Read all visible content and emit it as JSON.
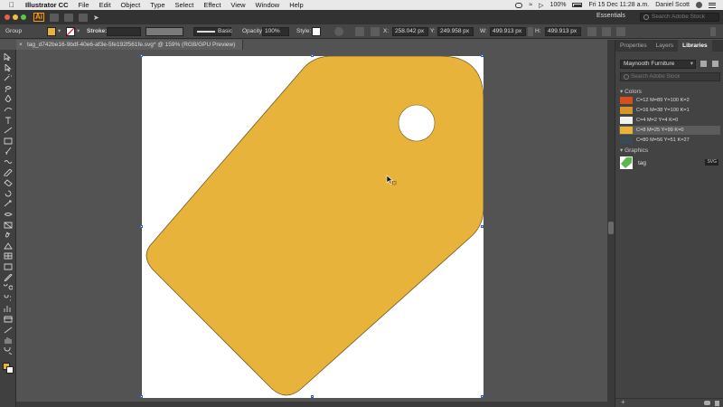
{
  "mac_menu": {
    "app_name": "Illustrator CC",
    "items": [
      "File",
      "Edit",
      "Object",
      "Type",
      "Select",
      "Effect",
      "View",
      "Window",
      "Help"
    ],
    "battery": "100%",
    "datetime": "Fri 15 Dec  11:28 a.m.",
    "user": "Daniel Scott"
  },
  "app_bar": {
    "logo": "Ai",
    "workspace": "Essentials",
    "search_placeholder": "Search Adobe Stock"
  },
  "control_bar": {
    "selection_label": "Group",
    "stroke_label": "Stroke:",
    "brush_label": "Basic",
    "opacity_label": "Opacity:",
    "opacity_value": "100%",
    "style_label": "Style:",
    "x_label": "X:",
    "x_value": "258.042 px",
    "y_label": "Y:",
    "y_value": "249.958 px",
    "w_label": "W:",
    "w_value": "499.913 px",
    "h_label": "H:",
    "h_value": "499.913 px",
    "fill_color": "#e8b33a"
  },
  "document_tab": {
    "title": "tag_d742be16-9bdf-40e6-af3e-5fe192f561fe.svg* @ 159% (RGB/GPU Preview)",
    "close": "×"
  },
  "artwork": {
    "tag_color": "#e8b33a",
    "hole_color": "#ffffff"
  },
  "panel": {
    "tabs": [
      "Properties",
      "Layers",
      "Libraries"
    ],
    "active_tab": "Libraries",
    "library_name": "Maynooth Furniture",
    "search_placeholder": "Search Adobe Stock",
    "colors_header": "Colors",
    "colors": [
      {
        "label": "C=12 M=89 Y=100 K=2",
        "hex": "#d6501d"
      },
      {
        "label": "C=16 M=38 Y=100 K=1",
        "hex": "#d6962a"
      },
      {
        "label": "C=4 M=2 Y=4 K=0",
        "hex": "#f2f2ee"
      },
      {
        "label": "C=8 M=25 Y=99 K=0",
        "hex": "#e8b33a"
      },
      {
        "label": "C=80 M=56 Y=51 K=27",
        "hex": "#3a4b55"
      }
    ],
    "selected_color_index": 3,
    "graphics_header": "Graphics",
    "graphic_name": "tag",
    "graphic_type": "SVG"
  }
}
